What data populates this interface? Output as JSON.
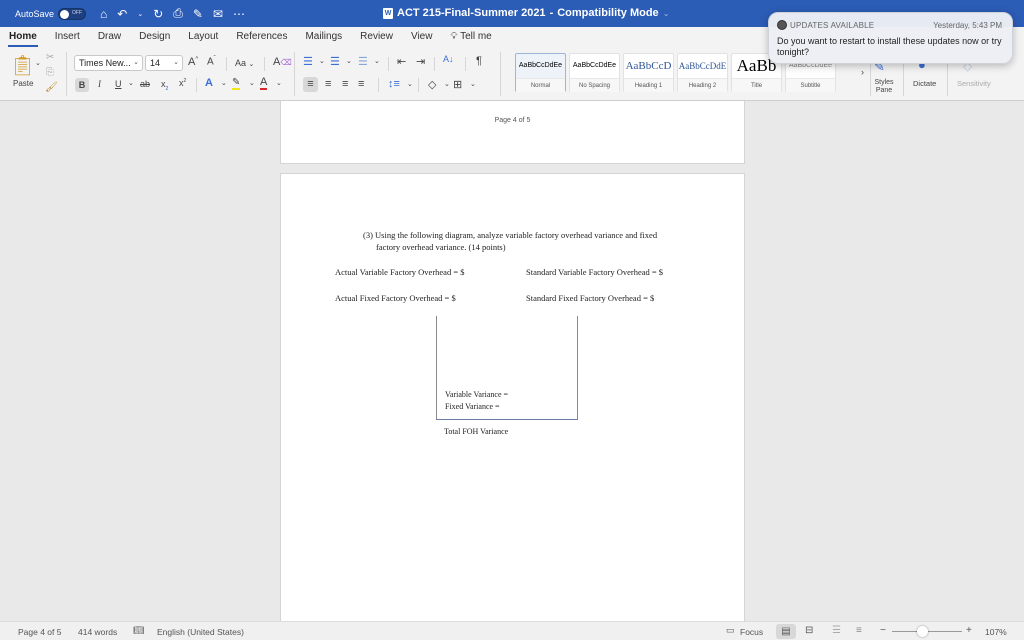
{
  "titlebar": {
    "autosave_label": "AutoSave",
    "autosave_state": "OFF",
    "document_title": "ACT 215-Final-Summer 2021",
    "separator": "-",
    "mode": "Compatibility Mode",
    "quick_access": [
      "home-icon",
      "undo-icon",
      "redo-icon",
      "print-icon",
      "edit-icon",
      "mail-icon",
      "more-icon"
    ]
  },
  "tabs": [
    {
      "label": "Home",
      "active": true
    },
    {
      "label": "Insert"
    },
    {
      "label": "Draw"
    },
    {
      "label": "Design"
    },
    {
      "label": "Layout"
    },
    {
      "label": "References"
    },
    {
      "label": "Mailings"
    },
    {
      "label": "Review"
    },
    {
      "label": "View"
    },
    {
      "label": "Tell me"
    }
  ],
  "ribbon": {
    "paste_label": "Paste",
    "font_name": "Times New...",
    "font_size": "14",
    "change_case": "Aa",
    "styles": [
      {
        "preview": "AaBbCcDdEe",
        "name": "Normal",
        "selected": true
      },
      {
        "preview": "AaBbCcDdEe",
        "name": "No Spacing"
      },
      {
        "preview": "AaBbCcD",
        "name": "Heading 1"
      },
      {
        "preview": "AaBbCcDdE",
        "name": "Heading 2"
      },
      {
        "preview": "AaBb",
        "name": "Title"
      },
      {
        "preview": "AaBbCcDdEe",
        "name": "Subtitle"
      }
    ],
    "styles_pane_label": "Styles Pane",
    "dictate_label": "Dictate",
    "sensitivity_label": "Sensitivity"
  },
  "notification": {
    "app": "UPDATES AVAILABLE",
    "time": "Yesterday, 5:43 PM",
    "message": "Do you want to restart to install these updates now or try tonight?"
  },
  "document": {
    "header_text": "Page 4 of 5",
    "question_line1": "(3) Using the following diagram, analyze variable factory overhead variance and fixed",
    "question_line2": "factory overhead variance. (14 points)",
    "actual_variable": "Actual Variable Factory Overhead = $",
    "standard_variable": "Standard Variable Factory Overhead = $",
    "actual_fixed": "Actual Fixed Factory Overhead = $",
    "standard_fixed": "Standard Fixed Factory Overhead = $",
    "variable_variance": "Variable Variance =",
    "fixed_variance": "Fixed Variance =",
    "total_variance": "Total FOH Variance"
  },
  "statusbar": {
    "page": "Page 4 of 5",
    "words": "414 words",
    "language": "English (United States)",
    "focus_label": "Focus",
    "zoom_level": "107%",
    "zoom_fraction": 0.43
  }
}
